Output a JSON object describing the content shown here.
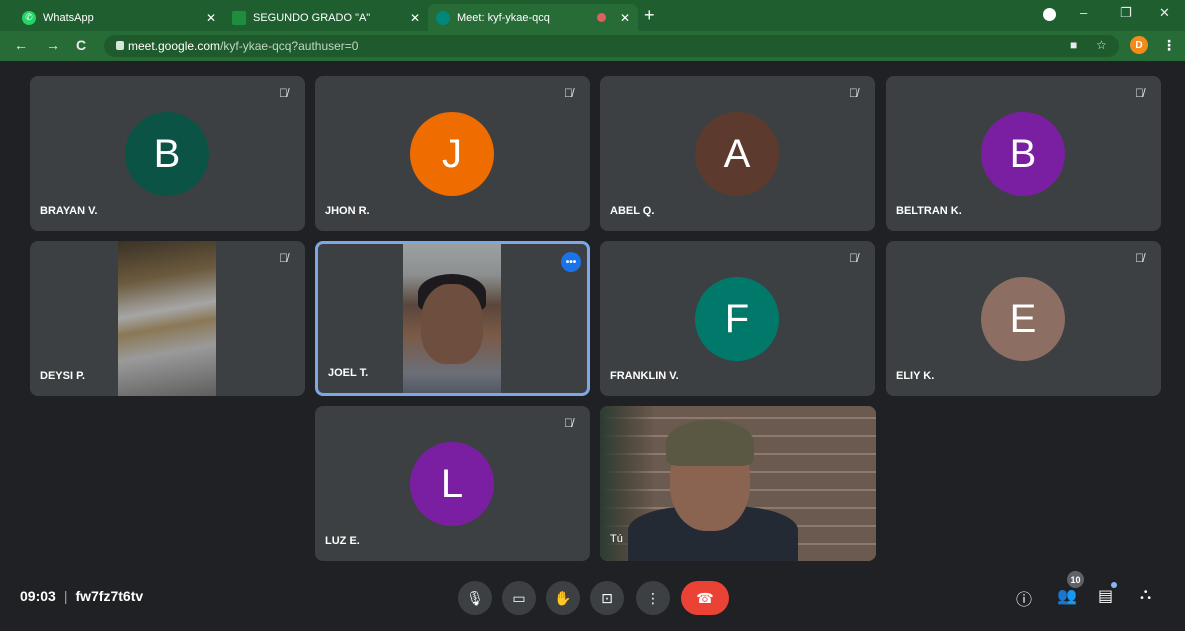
{
  "browser": {
    "tabs": [
      {
        "label": "WhatsApp",
        "favicon": "whatsapp-icon",
        "favicon_color": "#25d366"
      },
      {
        "label": "SEGUNDO GRADO \"A\"",
        "favicon": "classroom-icon",
        "favicon_color": "#1e8e3e"
      },
      {
        "label": "Meet: kyf-ykae-qcq",
        "favicon": "meet-icon",
        "favicon_color": "#00897b"
      }
    ],
    "url_host": "meet.google.com",
    "url_path": "/kyf-ykae-qcq?authuser=0",
    "profile_initial": "D"
  },
  "participants": [
    {
      "name": "BRAYAN V.",
      "initial": "B",
      "color": "#0b5345",
      "muted": true
    },
    {
      "name": "JHON R.",
      "initial": "J",
      "color": "#ef6c00",
      "muted": true
    },
    {
      "name": "ABEL Q.",
      "initial": "A",
      "color": "#5d3a2e",
      "muted": true
    },
    {
      "name": "BELTRAN K.",
      "initial": "B",
      "color": "#7b1fa2",
      "muted": true
    },
    {
      "name": "DEYSI P.",
      "video": true,
      "muted": true
    },
    {
      "name": "JOEL T.",
      "video": true,
      "selected": true
    },
    {
      "name": "FRANKLIN V.",
      "initial": "F",
      "color": "#00796b",
      "muted": true
    },
    {
      "name": "ELIY K.",
      "initial": "E",
      "color": "#8d6e63",
      "muted": true
    },
    {
      "name": "LUZ E.",
      "initial": "L",
      "color": "#7b1fa2",
      "muted": true
    },
    {
      "name": "Tú",
      "video": true
    }
  ],
  "bottom": {
    "time": "09:03",
    "meeting_code": "fw7fz7t6tv",
    "participant_count": "10"
  }
}
